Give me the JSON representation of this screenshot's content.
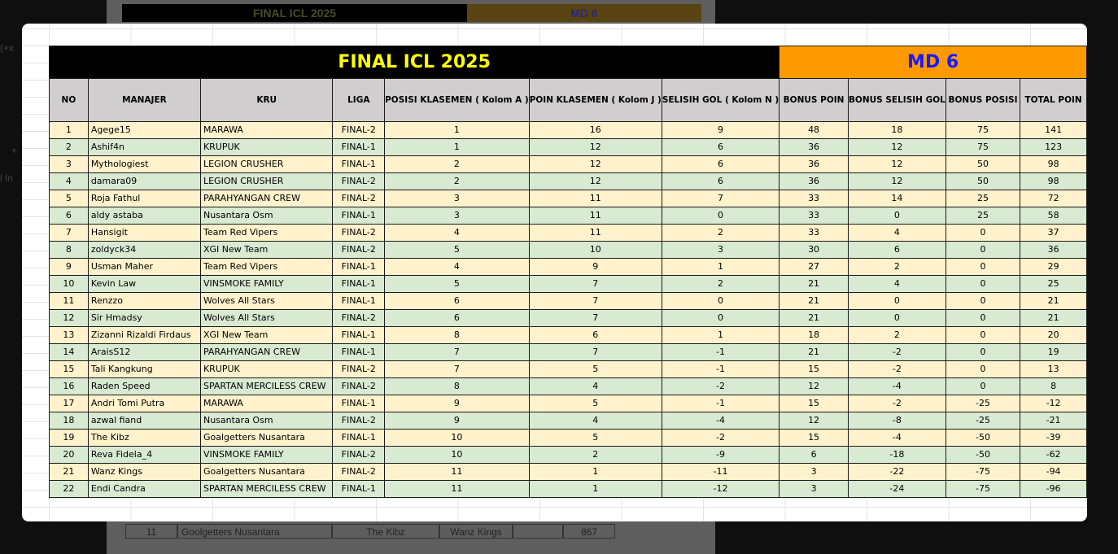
{
  "background": {
    "title": "FINAL ICL 2025",
    "md": "MD 6",
    "row": [
      "11",
      "Goolgetters Nusantara",
      "The Kibz",
      "Wanz Kings",
      "",
      "867"
    ],
    "left_marks": [
      "(+x",
      "+",
      "l In"
    ]
  },
  "table": {
    "title": "FINAL ICL 2025",
    "matchday": "MD 6",
    "headers": {
      "no": "NO",
      "manajer": "MANAJER",
      "kru": "KRU",
      "liga": "LIGA",
      "posisi": "POSISI KLASEMEN ( Kolom A )",
      "poin": "POIN KLASEMEN ( Kolom J )",
      "selisih": "SELISIH GOL ( Kolom N )",
      "bonus_poin": "BONUS POIN",
      "bonus_selisih": "BONUS SELISIH GOL",
      "bonus_posisi": "BONUS POSISI",
      "total": "TOTAL POIN"
    },
    "rows": [
      [
        "1",
        "Agege15",
        "MARAWA",
        "FINAL-2",
        "1",
        "16",
        "9",
        "48",
        "18",
        "75",
        "141"
      ],
      [
        "2",
        "Ashif4n",
        "KRUPUK",
        "FINAL-1",
        "1",
        "12",
        "6",
        "36",
        "12",
        "75",
        "123"
      ],
      [
        "3",
        "Mythologiest",
        "LEGION CRUSHER",
        "FINAL-1",
        "2",
        "12",
        "6",
        "36",
        "12",
        "50",
        "98"
      ],
      [
        "4",
        "damara09",
        "LEGION CRUSHER",
        "FINAL-2",
        "2",
        "12",
        "6",
        "36",
        "12",
        "50",
        "98"
      ],
      [
        "5",
        "Roja Fathul",
        "PARAHYANGAN CREW",
        "FINAL-2",
        "3",
        "11",
        "7",
        "33",
        "14",
        "25",
        "72"
      ],
      [
        "6",
        "aldy astaba",
        "Nusantara Osm",
        "FINAL-1",
        "3",
        "11",
        "0",
        "33",
        "0",
        "25",
        "58"
      ],
      [
        "7",
        "Hansigit",
        "Team Red Vipers",
        "FINAL-2",
        "4",
        "11",
        "2",
        "33",
        "4",
        "0",
        "37"
      ],
      [
        "8",
        "zoldyck34",
        "XGI New Team",
        "FINAL-2",
        "5",
        "10",
        "3",
        "30",
        "6",
        "0",
        "36"
      ],
      [
        "9",
        "Usman Maher",
        "Team Red Vipers",
        "FINAL-1",
        "4",
        "9",
        "1",
        "27",
        "2",
        "0",
        "29"
      ],
      [
        "10",
        "Kevin Law",
        "VINSMOKE FAMILY",
        "FINAL-1",
        "5",
        "7",
        "2",
        "21",
        "4",
        "0",
        "25"
      ],
      [
        "11",
        "Renzzo",
        "Wolves All Stars",
        "FINAL-1",
        "6",
        "7",
        "0",
        "21",
        "0",
        "0",
        "21"
      ],
      [
        "12",
        "Sir Hmadsy",
        "Wolves All Stars",
        "FINAL-2",
        "6",
        "7",
        "0",
        "21",
        "0",
        "0",
        "21"
      ],
      [
        "13",
        "Zizanni Rizaldi Firdaus",
        "XGI New Team",
        "FINAL-1",
        "8",
        "6",
        "1",
        "18",
        "2",
        "0",
        "20"
      ],
      [
        "14",
        "AraisS12",
        "PARAHYANGAN CREW",
        "FINAL-1",
        "7",
        "7",
        "-1",
        "21",
        "-2",
        "0",
        "19"
      ],
      [
        "15",
        "Tali Kangkung",
        "KRUPUK",
        "FINAL-2",
        "7",
        "5",
        "-1",
        "15",
        "-2",
        "0",
        "13"
      ],
      [
        "16",
        "Raden Speed",
        "SPARTAN MERCILESS CREW",
        "FINAL-2",
        "8",
        "4",
        "-2",
        "12",
        "-4",
        "0",
        "8"
      ],
      [
        "17",
        "Andri Tomi Putra",
        "MARAWA",
        "FINAL-1",
        "9",
        "5",
        "-1",
        "15",
        "-2",
        "-25",
        "-12"
      ],
      [
        "18",
        "azwal fiand",
        "Nusantara Osm",
        "FINAL-2",
        "9",
        "4",
        "-4",
        "12",
        "-8",
        "-25",
        "-21"
      ],
      [
        "19",
        "The Kibz",
        "Goalgetters Nusantara",
        "FINAL-1",
        "10",
        "5",
        "-2",
        "15",
        "-4",
        "-50",
        "-39"
      ],
      [
        "20",
        "Reva Fidela_4",
        "VINSMOKE FAMILY",
        "FINAL-2",
        "10",
        "2",
        "-9",
        "6",
        "-18",
        "-50",
        "-62"
      ],
      [
        "21",
        "Wanz Kings",
        "Goalgetters Nusantara",
        "FINAL-2",
        "11",
        "1",
        "-11",
        "3",
        "-22",
        "-75",
        "-94"
      ],
      [
        "22",
        "Endi Candra",
        "SPARTAN MERCILESS CREW",
        "FINAL-1",
        "11",
        "1",
        "-12",
        "3",
        "-24",
        "-75",
        "-96"
      ]
    ]
  },
  "colors": {
    "title_bg": "#000000",
    "title_text": "#ffff00",
    "md_bg": "#ff9900",
    "md_text": "#1a1aff",
    "header_bg": "#d0cece",
    "row_odd": "#fff2cc",
    "row_even": "#d9ead3"
  }
}
